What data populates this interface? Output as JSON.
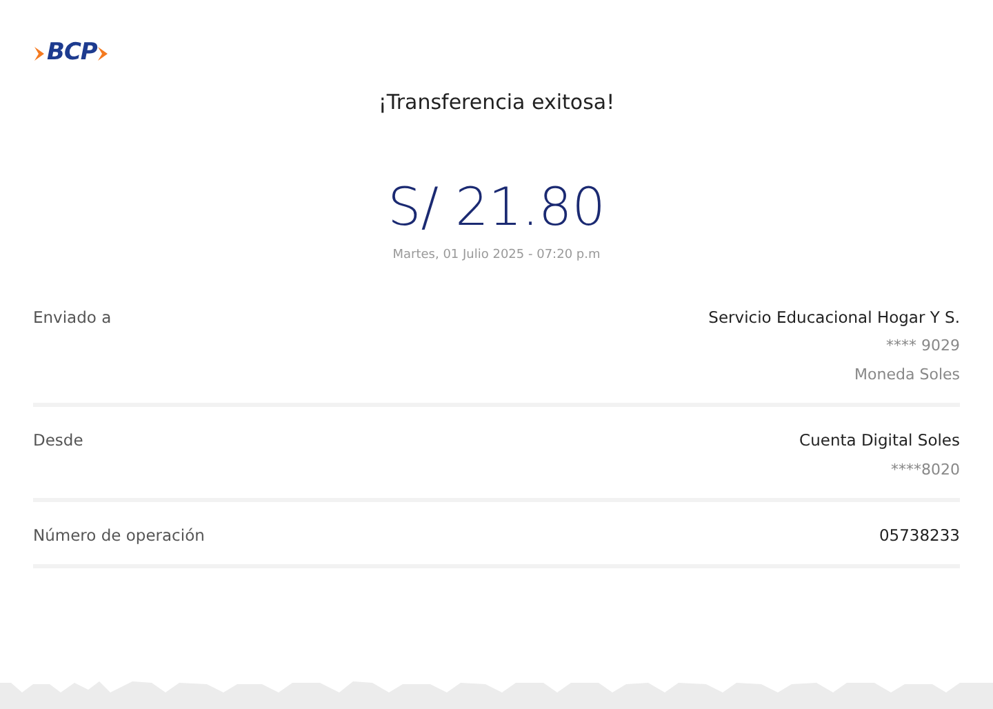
{
  "logo": {
    "text": "BCP"
  },
  "title": "¡Transferencia exitosa!",
  "amount": "S/ 21.80",
  "datetime": "Martes, 01 Julio 2025 - 07:20 p.m",
  "details": [
    {
      "label": "Enviado a",
      "values": [
        "Servicio Educacional Hogar Y S.",
        "**** 9029",
        "Moneda Soles"
      ]
    },
    {
      "label": "Desde",
      "values": [
        "Cuenta Digital Soles",
        "****8020"
      ]
    },
    {
      "label": "Número de operación",
      "values": [
        "05738233"
      ]
    }
  ]
}
